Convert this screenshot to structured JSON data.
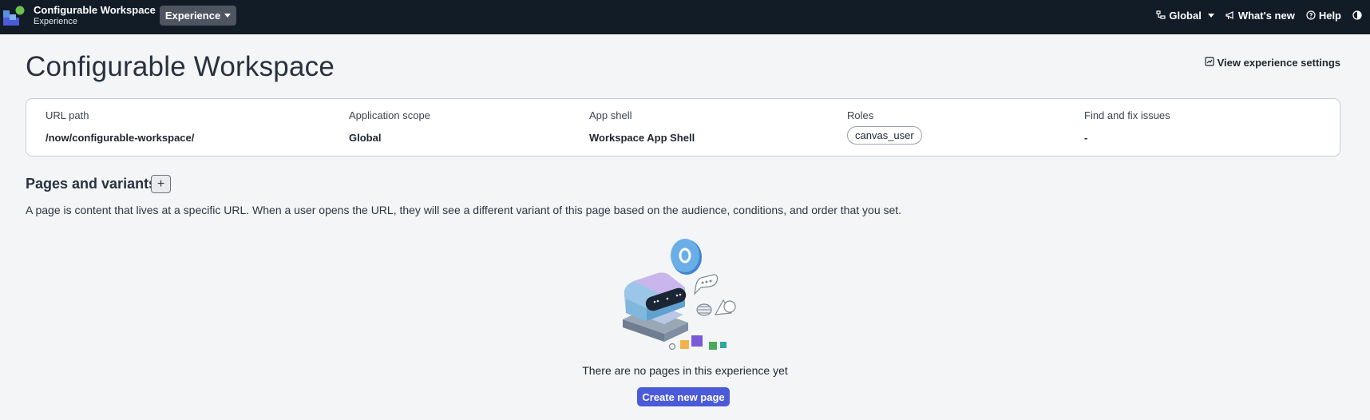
{
  "header": {
    "app_title": "Configurable Workspace",
    "app_subtitle": "Experience",
    "experience_menu": "Experience",
    "scope_menu": "Global",
    "whats_new": "What's new",
    "help": "Help"
  },
  "page": {
    "title": "Configurable Workspace",
    "view_settings": "View experience settings"
  },
  "details": {
    "url_path": {
      "label": "URL path",
      "value": "/now/configurable-workspace/"
    },
    "app_scope": {
      "label": "Application scope",
      "value": "Global"
    },
    "app_shell": {
      "label": "App shell",
      "value": "Workspace App Shell"
    },
    "roles": {
      "label": "Roles",
      "value": "canvas_user"
    },
    "issues": {
      "label": "Find and fix issues",
      "value": "-"
    }
  },
  "pages_section": {
    "title": "Pages and variants",
    "add_label": "+",
    "description": "A page is content that lives at a specific URL. When a user opens the URL, they will see a different variant of this page based on the audience, conditions, and order that you set.",
    "empty_text": "There are no pages in this experience yet",
    "create_button": "Create new page"
  },
  "colors": {
    "topbar": "#121c27",
    "primary_button": "#4a5ad8",
    "page_background": "#f4f5f7"
  }
}
